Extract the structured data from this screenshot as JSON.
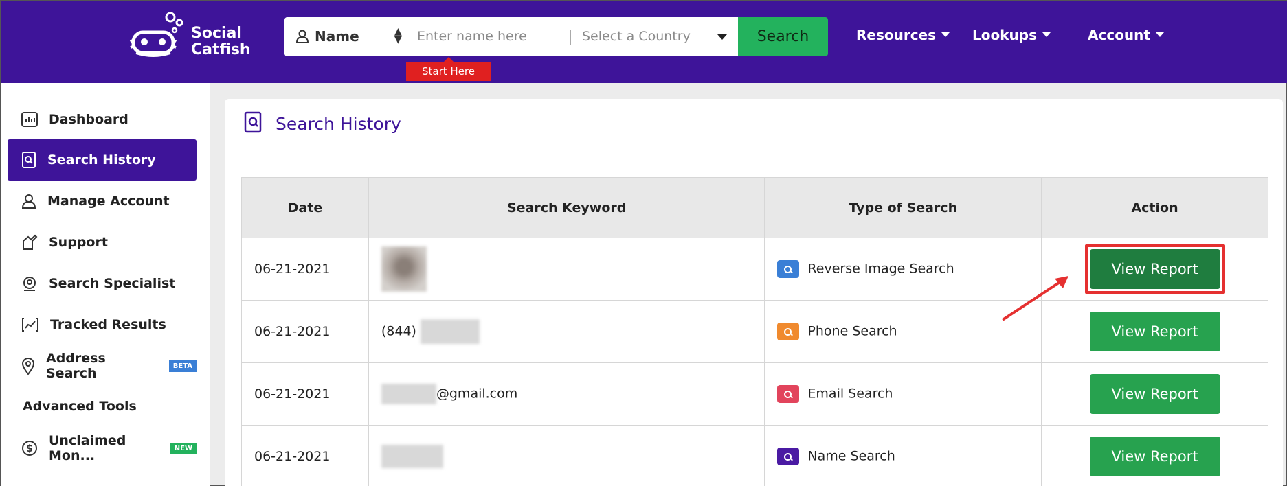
{
  "brand": {
    "name_line1": "Social",
    "name_line2": "Catfish"
  },
  "search": {
    "type_label": "Name",
    "input_placeholder": "Enter name here",
    "country_placeholder": "Select a Country",
    "button_label": "Search",
    "hint": "Start Here"
  },
  "nav": {
    "resources": "Resources",
    "lookups": "Lookups",
    "account": "Account"
  },
  "sidebar": {
    "items": [
      {
        "label": "Dashboard",
        "icon": "chart-icon"
      },
      {
        "label": "Search History",
        "icon": "search-doc-icon"
      },
      {
        "label": "Manage Account",
        "icon": "user-icon"
      },
      {
        "label": "Support",
        "icon": "support-icon"
      },
      {
        "label": "Search Specialist",
        "icon": "specialist-icon"
      },
      {
        "label": "Tracked Results",
        "icon": "tracked-icon"
      },
      {
        "label": "Address Search",
        "icon": "location-icon",
        "badge": "BETA"
      }
    ],
    "advanced_header": "Advanced Tools",
    "advanced_items": [
      {
        "label": "Unclaimed Mon...",
        "icon": "dollar-icon",
        "badge": "NEW"
      }
    ]
  },
  "page": {
    "title": "Search History"
  },
  "table": {
    "headers": [
      "Date",
      "Search Keyword",
      "Type of Search",
      "Action"
    ],
    "rows": [
      {
        "date": "06-21-2021",
        "keyword": "",
        "type": "Reverse Image Search",
        "type_color": "#3a7fd6",
        "action": "View Report"
      },
      {
        "date": "06-21-2021",
        "keyword": "(844)",
        "type": "Phone Search",
        "type_color": "#f08a2e",
        "action": "View Report"
      },
      {
        "date": "06-21-2021",
        "keyword": "@gmail.com",
        "type": "Email Search",
        "type_color": "#e2445c",
        "action": "View Report"
      },
      {
        "date": "06-21-2021",
        "keyword": "",
        "type": "Name Search",
        "type_color": "#4a1aa3",
        "action": "View Report"
      }
    ]
  },
  "colors": {
    "brand": "#3e1499",
    "search_green": "#23b25d",
    "view_green": "#27a24f",
    "highlight_red": "#e53030"
  }
}
